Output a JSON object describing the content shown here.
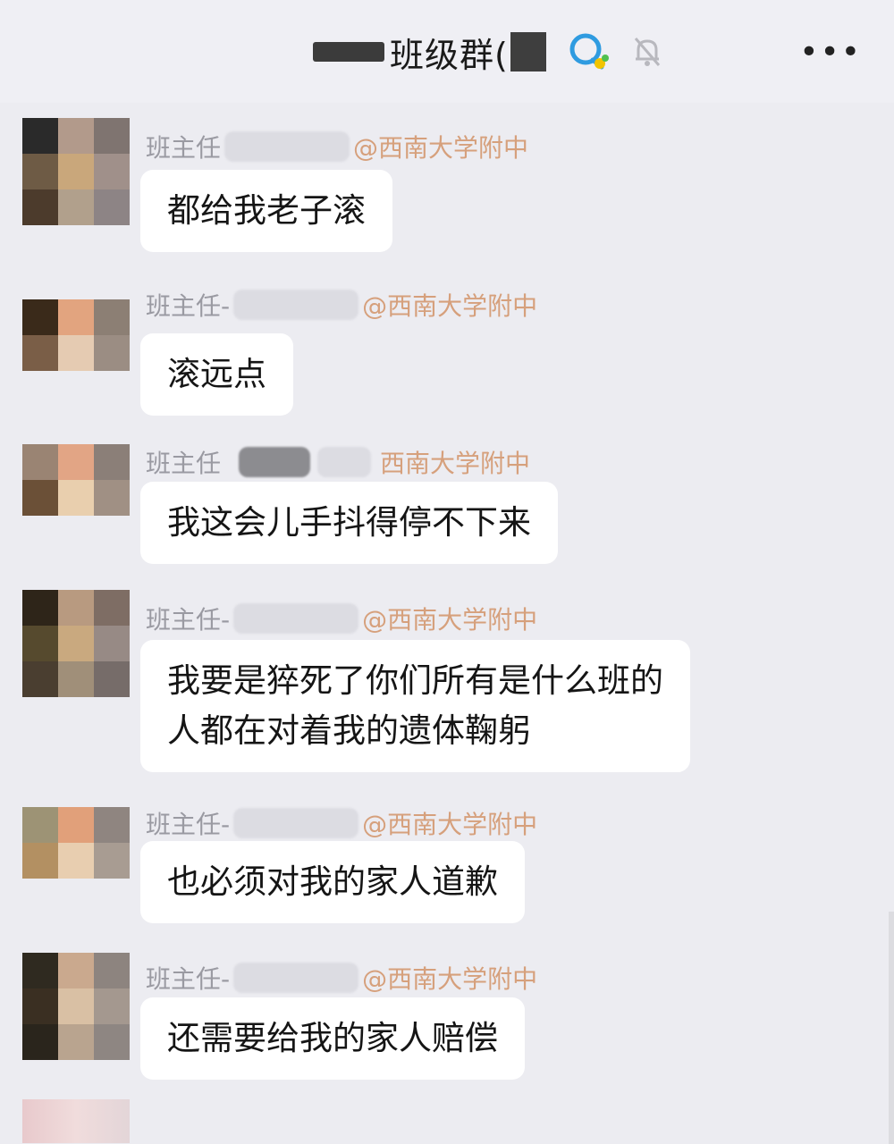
{
  "header": {
    "title": "班级群(",
    "more_icon": "more-dots-icon",
    "qq_icon": "qq-chat-icon",
    "mute_icon": "bell-muted-icon"
  },
  "messages": [
    {
      "role": "班主任",
      "school": "@西南大学附中",
      "text": "都给我老子滚"
    },
    {
      "role": "班主任-",
      "school": "@西南大学附中",
      "text": "滚远点"
    },
    {
      "role": "班主任",
      "school": "西南大学附中",
      "text": "我这会儿手抖得停不下来"
    },
    {
      "role": "班主任-",
      "school": "@西南大学附中",
      "text": "我要是猝死了你们所有是什么班的\n人都在对着我的遗体鞠躬"
    },
    {
      "role": "班主任-",
      "school": "@西南大学附中",
      "text": "也必须对我的家人道歉"
    },
    {
      "role": "班主任-",
      "school": "@西南大学附中",
      "text": "还需要给我的家人赔偿"
    }
  ],
  "colors": {
    "background": "#ececf1",
    "bubble": "#ffffff",
    "school_tag": "#d6a07c",
    "role": "#9a9aa2"
  }
}
